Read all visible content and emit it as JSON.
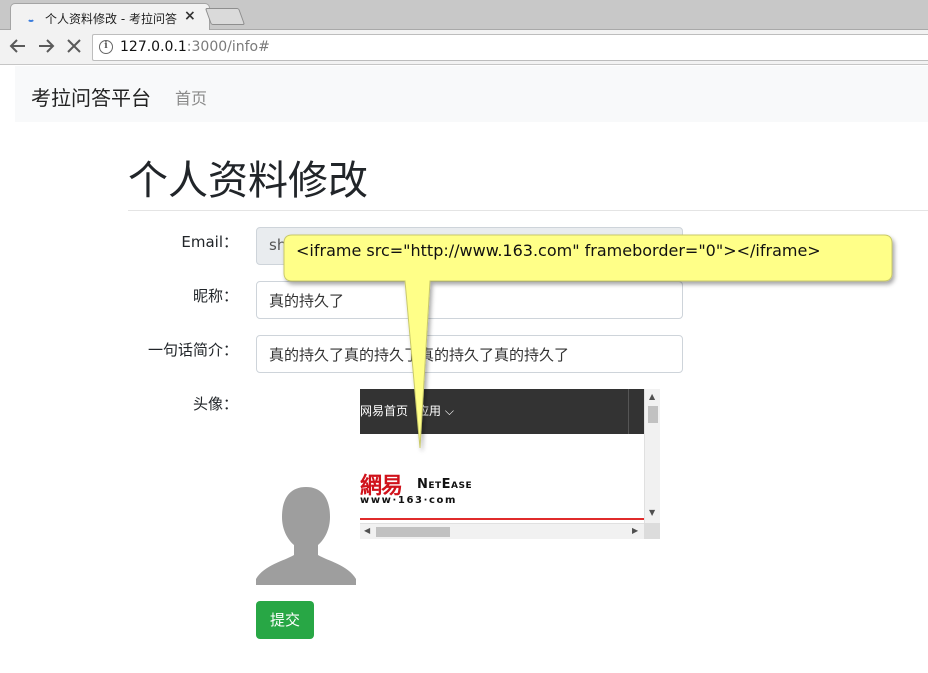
{
  "browser": {
    "tab_title": "个人资料修改 - 考拉问答",
    "tab_close": "×",
    "url_host": "127.0.0.1",
    "url_rest": ":3000/info#",
    "info_icon": "i"
  },
  "navbar": {
    "brand": "考拉问答平台",
    "home": "首页"
  },
  "page": {
    "title": "个人资料修改"
  },
  "form": {
    "email_label": "Email：",
    "email_value": "sh",
    "nickname_label": "昵称：",
    "nickname_value": "真的持久了",
    "bio_label": "一句话简介：",
    "bio_value": "真的持久了真的持久了真的持久了真的持久了",
    "avatar_label": "头像：",
    "submit_label": "提交"
  },
  "iframe": {
    "home_link": "网易首页",
    "apps_link": "应用 ⌵",
    "logo_cn": "網易",
    "logo_en": "NetEase",
    "logo_url": "www·163·com"
  },
  "tooltip": {
    "text": "<iframe src=\"http://www.163.com\" frameborder=\"0\"></iframe>"
  },
  "colors": {
    "submit_bg": "#28a745",
    "tooltip_bg": "#ffff88",
    "netease_red": "#d0121b"
  },
  "icons": [
    "back-arrow-icon",
    "forward-arrow-icon",
    "stop-icon",
    "info-icon",
    "tab-close-icon",
    "avatar-placeholder-icon"
  ]
}
